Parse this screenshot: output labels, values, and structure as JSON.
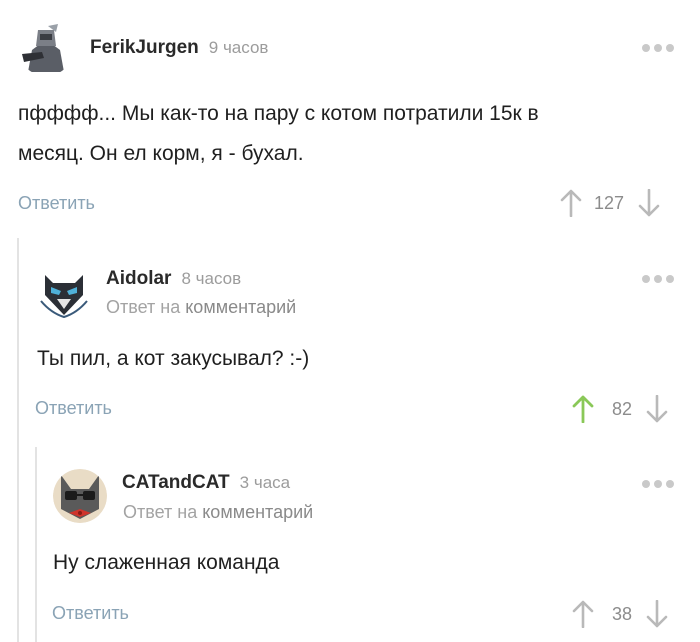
{
  "comments": [
    {
      "author": "FerikJurgen",
      "time": "9 часов",
      "text_line1": "пфффф... Мы как-то на пару с котом потратили 15к в",
      "text_line2": "месяц. Он ел корм, я - бухал.",
      "reply_label": "Ответить",
      "rating": "127",
      "upvoted": false
    },
    {
      "author": "Aidolar",
      "time": "8 часов",
      "reply_prefix": "Ответ на",
      "reply_link": "комментарий",
      "text": "Ты пил, а кот закусывал? :-)",
      "reply_label": "Ответить",
      "rating": "82",
      "upvoted": true
    },
    {
      "author": "CATandCAT",
      "time": "3 часа",
      "reply_prefix": "Ответ на",
      "reply_link": "комментарий",
      "text": "Ну слаженная команда",
      "reply_label": "Ответить",
      "rating": "38",
      "upvoted": false
    }
  ],
  "colors": {
    "upvote_active": "#8ac858",
    "arrow_inactive": "#b9b9b9",
    "reply_link": "#8aa3b5"
  }
}
